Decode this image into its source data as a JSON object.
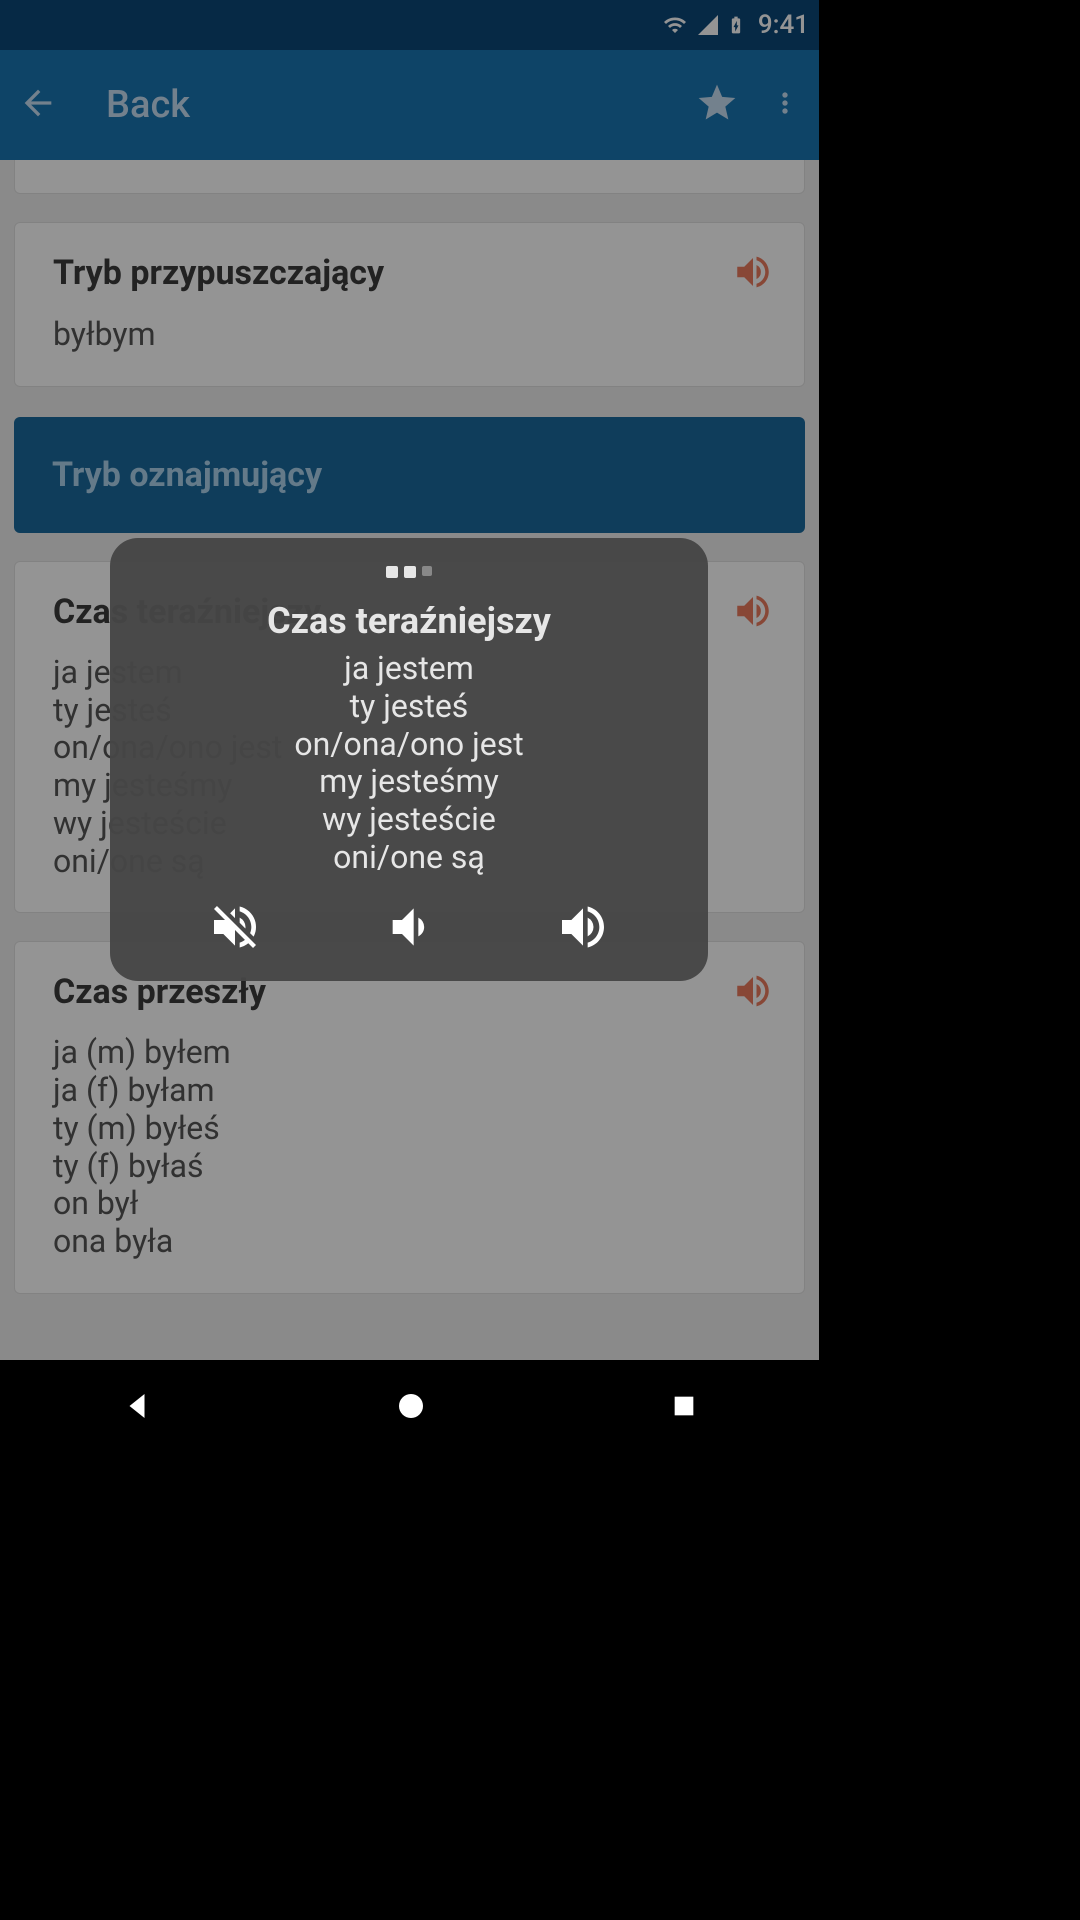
{
  "status": {
    "time": "9:41"
  },
  "appbar": {
    "title": "Back"
  },
  "cards": {
    "conditional": {
      "title": "Tryb przypuszczający",
      "sub": "byłbym"
    },
    "indicative_header": {
      "title": "Tryb oznajmujący"
    },
    "present": {
      "title": "Czas teraźniejszy",
      "lines": [
        "ja jestem",
        "ty jesteś",
        "on/ona/ono jest",
        "my jesteśmy",
        "wy jesteście",
        "oni/one są"
      ]
    },
    "past": {
      "title": "Czas przeszły",
      "lines": [
        "ja (m) byłem",
        "ja (f) byłam",
        "ty (m) byłeś",
        "ty (f) byłaś",
        "on był",
        "ona była"
      ]
    }
  },
  "popup": {
    "title": "Czas teraźniejszy",
    "lines": [
      "ja jestem",
      "ty jesteś",
      "on/ona/ono jest",
      "my jesteśmy",
      "wy jesteście",
      "oni/one są"
    ]
  }
}
